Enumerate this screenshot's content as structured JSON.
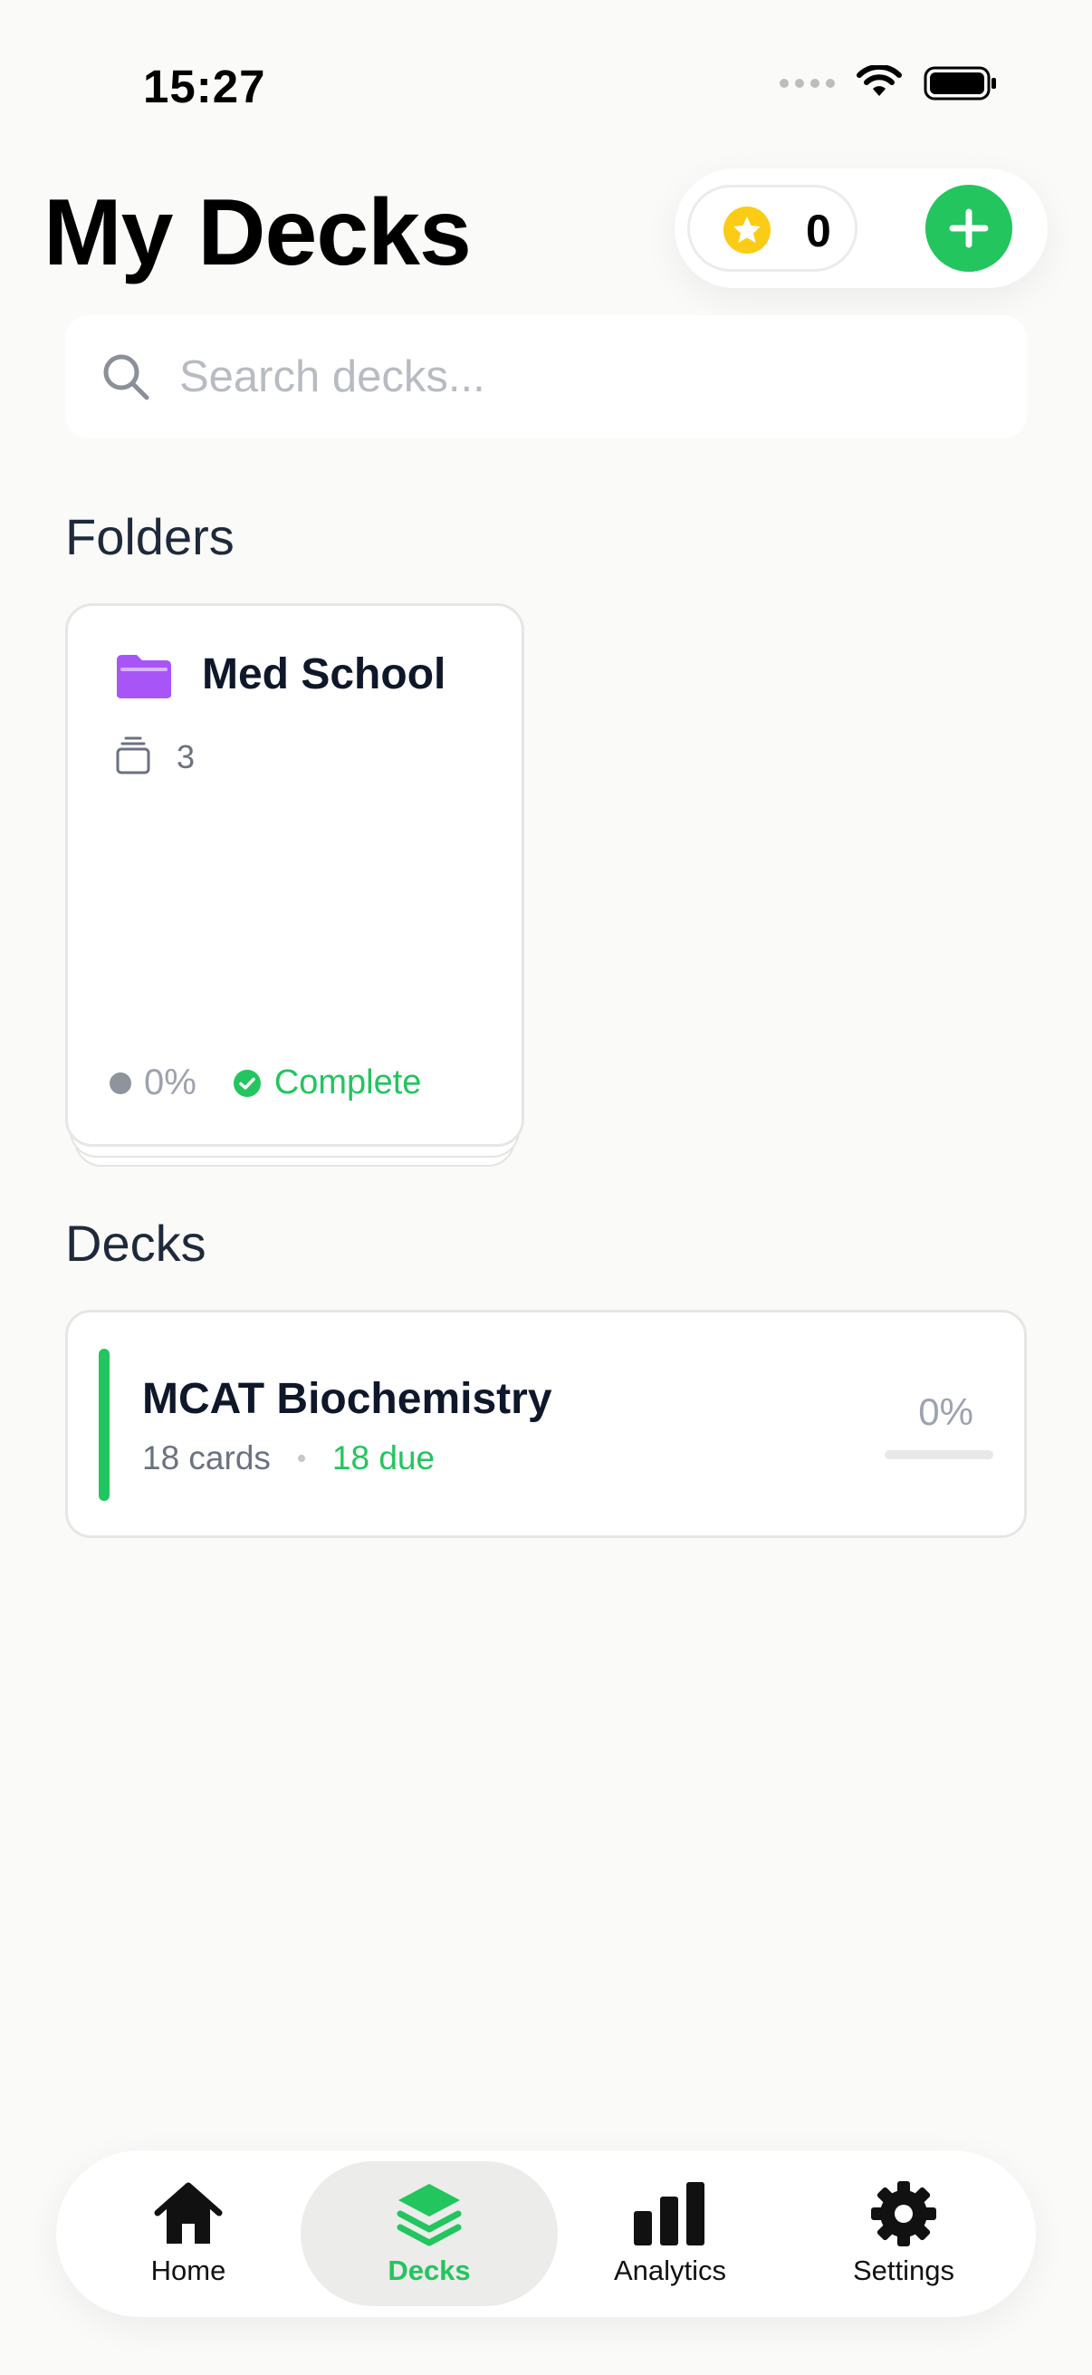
{
  "status_bar": {
    "time": "15:27"
  },
  "header": {
    "title": "My Decks",
    "coin_count": "0"
  },
  "search": {
    "placeholder": "Search decks..."
  },
  "folders": {
    "heading": "Folders",
    "items": [
      {
        "name": "Med School",
        "deck_count": "3",
        "progress": "0%",
        "status": "Complete",
        "icon_color": "#A855F7"
      }
    ]
  },
  "decks": {
    "heading": "Decks",
    "items": [
      {
        "name": "MCAT Biochemistry",
        "cards": "18 cards",
        "due": "18 due",
        "progress": "0%",
        "progress_fraction": 0,
        "accent_color": "#22C55E"
      }
    ]
  },
  "tab_bar": {
    "tabs": [
      {
        "label": "Home",
        "icon": "home-icon"
      },
      {
        "label": "Decks",
        "icon": "decks-icon",
        "active": true
      },
      {
        "label": "Analytics",
        "icon": "analytics-icon"
      },
      {
        "label": "Settings",
        "icon": "settings-icon"
      }
    ]
  },
  "colors": {
    "accent": "#22C55E",
    "background": "#FAFAF8",
    "folder": "#A855F7",
    "coin": "#FACC15"
  }
}
